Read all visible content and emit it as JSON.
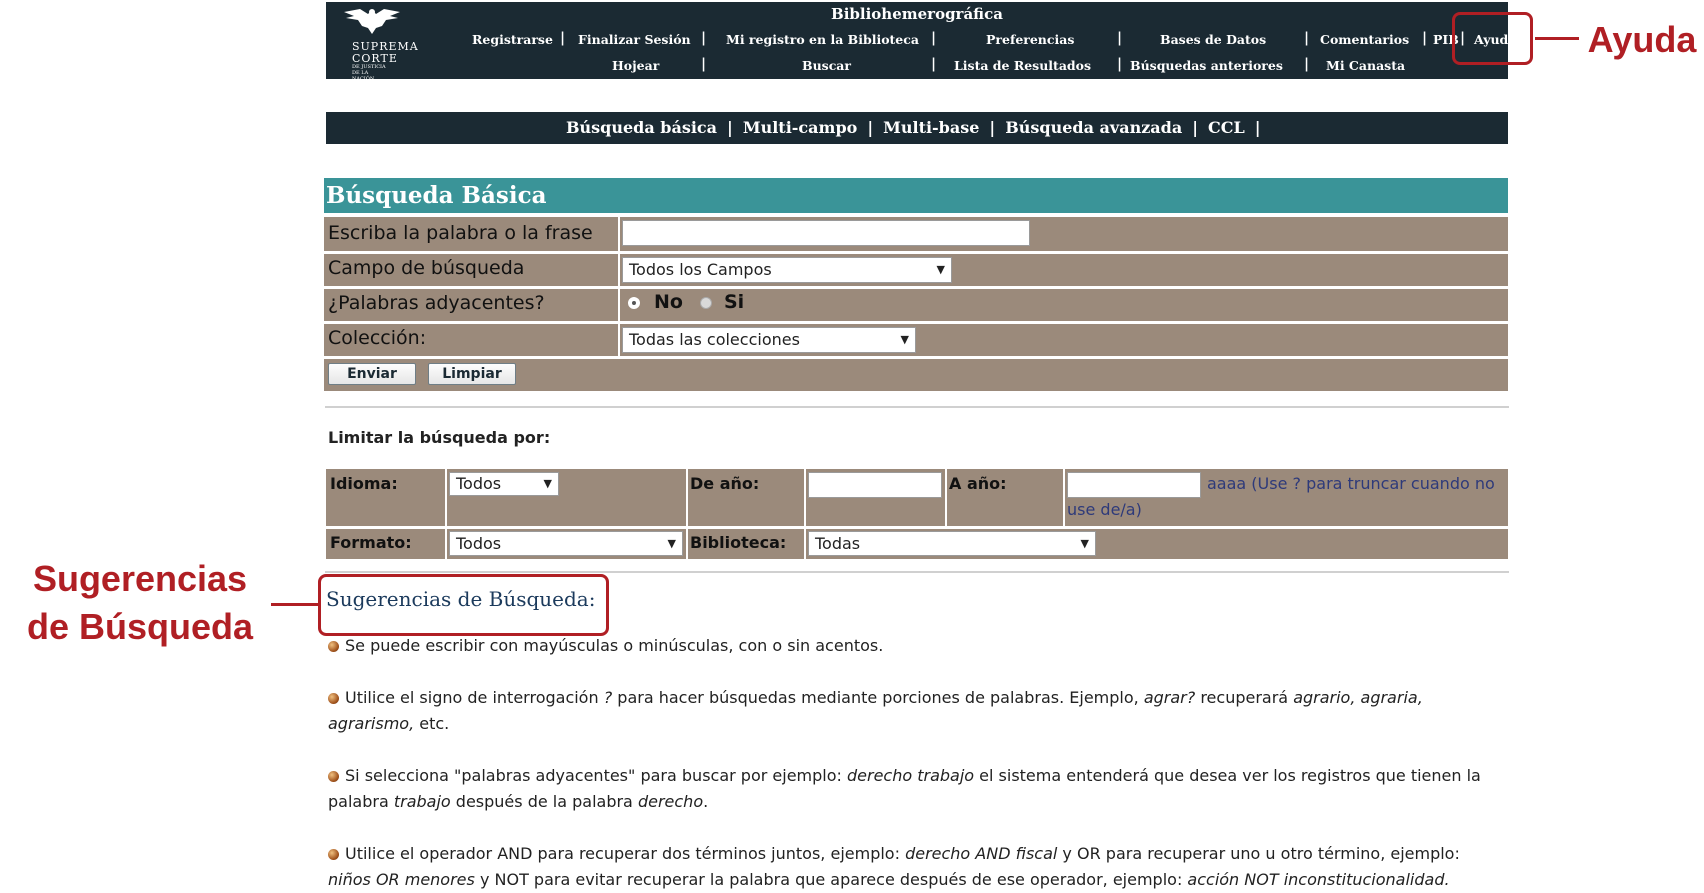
{
  "header": {
    "logo": {
      "line1": "SUPREMA",
      "line2": "CORTE",
      "line3": "DE JUSTICIA DE LA NACIÓN"
    },
    "title": "Bibliohemerográfica",
    "nav_row1": [
      "Registrarse",
      "Finalizar Sesión",
      "Mi registro en la Biblioteca",
      "Preferencias",
      "Bases de Datos",
      "Comentarios",
      "PIB",
      "Ayuda"
    ],
    "nav_row2": [
      "Hojear",
      "Buscar",
      "Lista de Resultados",
      "Búsquedas anteriores",
      "Mi Canasta"
    ],
    "separator": "|"
  },
  "search_tabs": [
    "Búsqueda básica",
    "Multi-campo",
    "Multi-base",
    "Búsqueda avanzada",
    "CCL"
  ],
  "basic_search": {
    "title": "Búsqueda Básica",
    "phrase_label": "Escriba la palabra o la frase",
    "phrase_value": "",
    "field_label": "Campo de búsqueda",
    "field_value": "Todos los Campos",
    "adjacent_label": "¿Palabras adyacentes?",
    "adjacent_no": "No",
    "adjacent_yes": "Si",
    "adjacent_selected": "No",
    "collection_label": "Colección:",
    "collection_value": "Todas las colecciones",
    "submit_label": "Enviar",
    "clear_label": "Limpiar"
  },
  "limits": {
    "title": "Limitar la búsqueda por:",
    "language_label": "Idioma:",
    "language_value": "Todos",
    "from_year_label": "De año:",
    "from_year_value": "",
    "to_year_label": "A año:",
    "to_year_value": "",
    "year_hint_1": "aaaa (Use ? para truncar cuando no",
    "year_hint_2": "use de/a)",
    "format_label": "Formato:",
    "format_value": "Todos",
    "library_label": "Biblioteca:",
    "library_value": "Todas"
  },
  "suggestions": {
    "title": "Sugerencias de Búsqueda",
    "title_colon": ":",
    "tip1": "Se puede escribir con mayúsculas o minúsculas, con o sin acentos.",
    "tip2": {
      "a": "Utilice el signo de interrogación ",
      "b": "?",
      "c": "  para hacer búsquedas mediante porciones de palabras. Ejemplo, ",
      "d": "agrar?",
      "e": " recuperará ",
      "f": "agrario, agraria,",
      "g": "agrarismo,",
      "h": " etc."
    },
    "tip3": {
      "a": "Si selecciona \"palabras adyacentes\" para buscar por ejemplo: ",
      "b": "derecho trabajo",
      "c": "  el sistema entenderá que desea ver los registros que tienen la",
      "d": "palabra ",
      "e": "trabajo",
      "f": "  después de la palabra ",
      "g": "derecho",
      "h": "."
    },
    "tip4": {
      "a": "Utilice el operador AND para recuperar dos términos juntos, ejemplo: ",
      "b": "derecho AND fiscal",
      "c": " y OR para recuperar uno u otro término, ejemplo:",
      "d": "niños OR menores",
      "e": " y NOT para evitar recuperar la palabra que aparece después de ese operador, ejemplo: ",
      "f": "acción NOT inconstitucionalidad.",
      "g": ""
    }
  },
  "annotations": {
    "ayuda": "Ayuda",
    "sugerencias_1": "Sugerencias",
    "sugerencias_2": "de Búsqueda"
  },
  "colors": {
    "header_bg": "#1b2a33",
    "section_teal": "#3a9498",
    "form_bg": "#9b8a7b",
    "annotation_red": "#b01f24"
  }
}
